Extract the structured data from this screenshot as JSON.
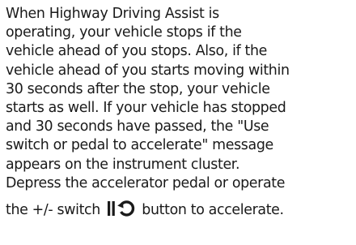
{
  "paragraph": {
    "lines": [
      "When Highway Driving Assist is",
      "operating, your vehicle stops if the",
      "vehicle ahead of you stops. Also, if the",
      "vehicle ahead of you starts moving within",
      "30 seconds after the stop, your vehicle",
      "starts as well. If your vehicle has stopped",
      "and 30 seconds have passed, the \"Use",
      "switch or pedal to accelerate\" message",
      "appears on the instrument cluster.",
      "Depress the accelerator pedal or operate"
    ],
    "last_line_before_icon": "the +/- switch",
    "last_line_after_icon": "button to accelerate.",
    "icon": "pause-resume-switch-icon"
  },
  "colors": {
    "text": "#1a1a1a",
    "background": "#ffffff"
  }
}
